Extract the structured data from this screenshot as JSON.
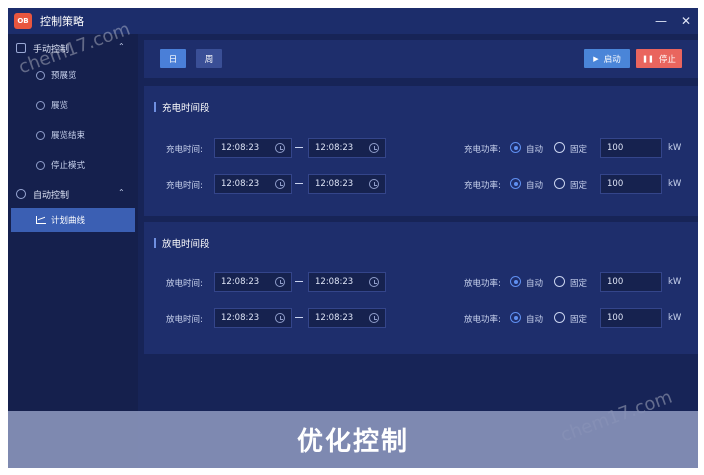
{
  "window": {
    "logo_text": "OB",
    "title": "控制策略",
    "minimize": "—",
    "close": "✕"
  },
  "sidebar": {
    "groups": [
      {
        "label": "手动控制",
        "expanded": true,
        "chevron": "⌃"
      },
      {
        "label": "自动控制",
        "expanded": true,
        "chevron": "⌃"
      }
    ],
    "items": [
      {
        "label": "预展览"
      },
      {
        "label": "展览"
      },
      {
        "label": "展览结束"
      },
      {
        "label": "停止模式"
      },
      {
        "label": "计划曲线",
        "active": true
      }
    ]
  },
  "toolbar": {
    "tab_day": "日",
    "tab_week": "周",
    "start_label": "启动",
    "start_glyph": "▶",
    "stop_label": "停止",
    "stop_glyph": "❚❚"
  },
  "charge": {
    "title": "充电时间段",
    "rows": [
      {
        "time_label": "充电时间:",
        "start": "12:08:23",
        "end": "12:08:23",
        "power_label": "充电功率:",
        "auto": "自动",
        "fixed": "固定",
        "value": "100",
        "unit": "kW"
      },
      {
        "time_label": "充电时间:",
        "start": "12:08:23",
        "end": "12:08:23",
        "power_label": "充电功率:",
        "auto": "自动",
        "fixed": "固定",
        "value": "100",
        "unit": "kW"
      }
    ]
  },
  "discharge": {
    "title": "放电时间段",
    "rows": [
      {
        "time_label": "放电时间:",
        "start": "12:08:23",
        "end": "12:08:23",
        "power_label": "放电功率:",
        "auto": "自动",
        "fixed": "固定",
        "value": "100",
        "unit": "kW"
      },
      {
        "time_label": "放电时间:",
        "start": "12:08:23",
        "end": "12:08:23",
        "power_label": "放电功率:",
        "auto": "自动",
        "fixed": "固定",
        "value": "100",
        "unit": "kW"
      }
    ]
  },
  "watermark": "chem17.com",
  "banner": {
    "text": "优化控制"
  },
  "colors": {
    "background": "#172457",
    "panel": "#1e2e6c",
    "accent": "#4a7fd8",
    "start": "#4a85d8",
    "stop": "#e9655e"
  }
}
